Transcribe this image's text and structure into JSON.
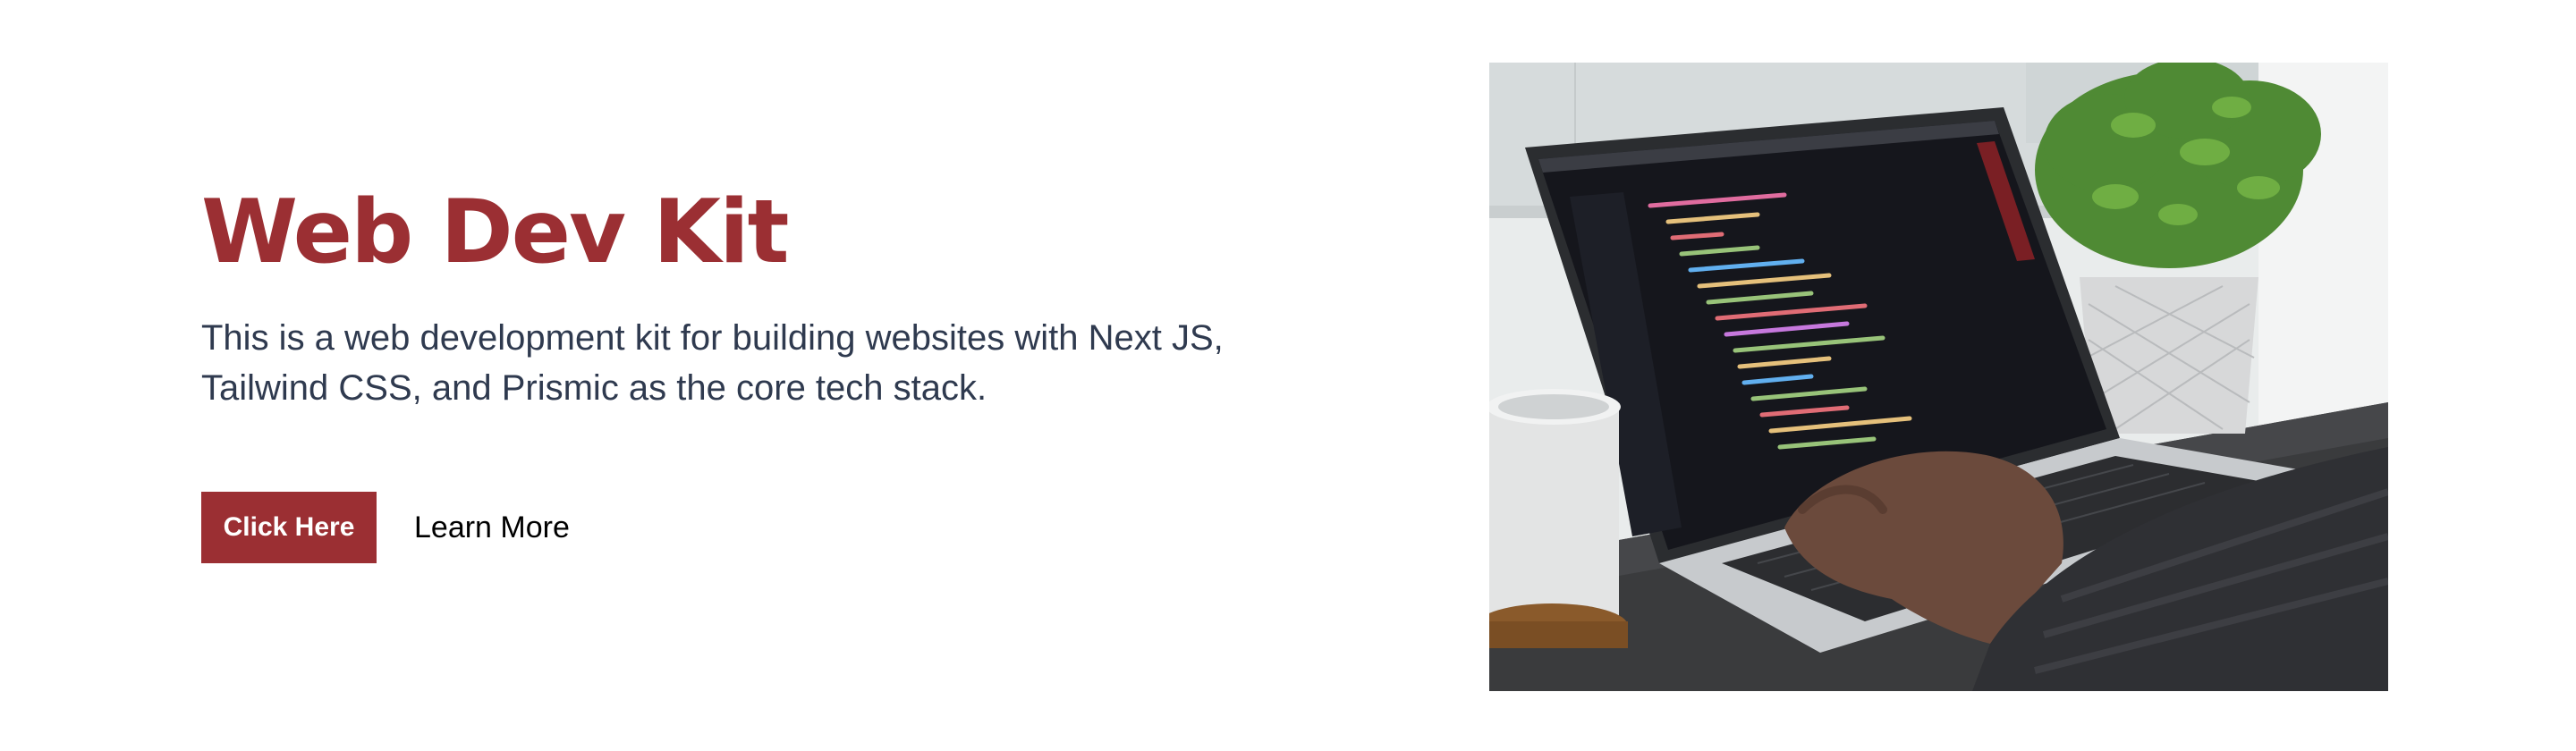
{
  "hero": {
    "title": "Web Dev Kit",
    "description": "This is a web development kit for building websites with Next JS, Tailwind CSS, and Prismic as the core tech stack.",
    "primary_button": "Click Here",
    "secondary_link": "Learn More",
    "image": "laptop-with-code-photo"
  },
  "colors": {
    "accent": "#9b2f33",
    "text": "#2f3a4f",
    "background": "#ffffff"
  }
}
